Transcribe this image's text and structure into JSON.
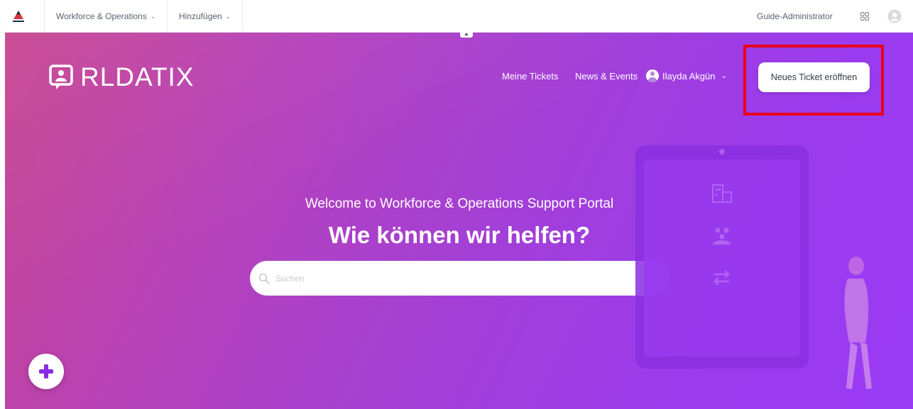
{
  "topbar": {
    "menu_workforce": "Workforce & Operations",
    "menu_add": "Hinzufügen",
    "admin_label": "Guide-Administrator",
    "icons": [
      "app-logo-icon",
      "chevron-down-icon",
      "apps-grid-icon",
      "user-profile-icon"
    ]
  },
  "hero": {
    "brand_text": "RLDATIX",
    "nav": {
      "my_tickets": "Meine Tickets",
      "news_events": "News & Events",
      "user_name": "Ilayda Akgün"
    },
    "new_ticket_button": "Neues Ticket eröffnen",
    "welcome": "Welcome to Workforce & Operations Support Portal",
    "headline": "Wie können wir helfen?",
    "search": {
      "placeholder": "Suchen",
      "value": ""
    }
  },
  "colors": {
    "gradient_start": "#c8458f",
    "gradient_end": "#993bf4",
    "highlight": "#e8001c",
    "fab_plus": "#8a2be2"
  }
}
